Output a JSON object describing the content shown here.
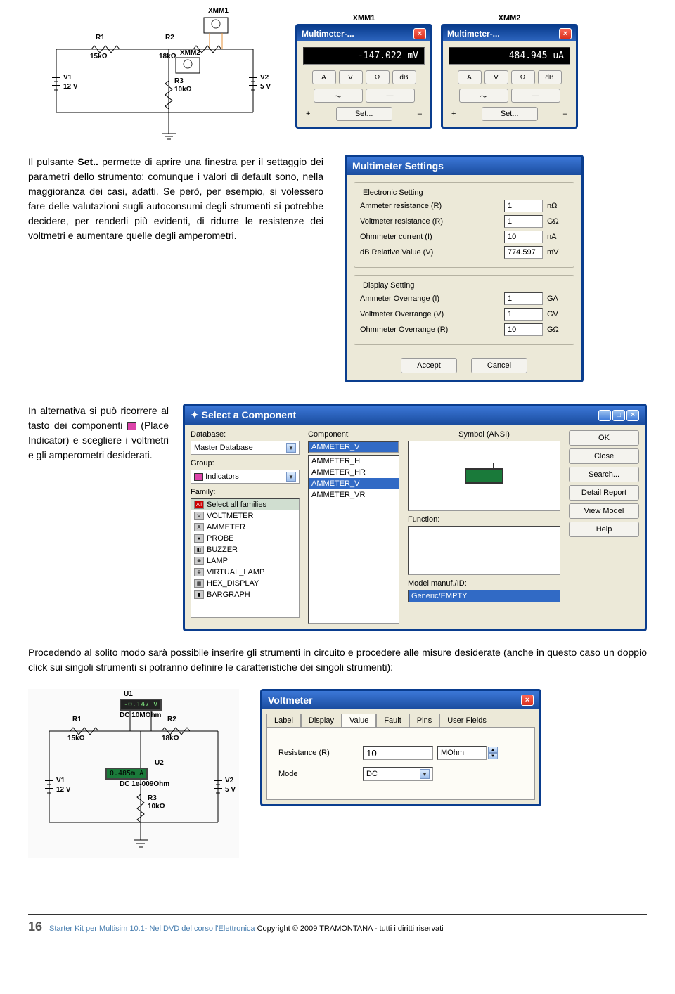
{
  "circuit1": {
    "xmm1_label": "XMM1",
    "xmm2_label": "XMM2",
    "r1": "R1",
    "r1_val": "15kΩ",
    "r2": "R2",
    "r2_val": "18kΩ",
    "r3": "R3",
    "r3_val": "10kΩ",
    "v1": "V1",
    "v1_val": "12 V",
    "v2": "V2",
    "v2_val": "5 V"
  },
  "meters": {
    "m1_label": "XMM1",
    "m2_label": "XMM2",
    "title": "Multimeter-...",
    "m1_value": "-147.022 mV",
    "m2_value": "484.945 uA",
    "btn_a": "A",
    "btn_v": "V",
    "btn_ohm": "Ω",
    "btn_db": "dB",
    "btn_ac": "〜",
    "btn_dc": "—",
    "plus": "+",
    "minus": "–",
    "set": "Set..."
  },
  "body_text": {
    "p1a": "Il pulsante ",
    "p1b": "Set..",
    "p1c": " permette di aprire una finestra per il settaggio dei parametri dello strumento: comunque i valori di default sono, nella maggioranza dei casi, adatti. Se però, per esempio, si volessero fare delle valutazioni sugli autoconsumi degli strumenti si potrebbe decidere, per renderli più evidenti, di ridurre le resistenze dei voltmetri e aumentare quelle degli amperometri.",
    "p2a": "In alternativa si può ricorrere al tasto dei componenti ",
    "p2b": " (Place Indicator) e scegliere i voltmetri e gli amperometri desiderati.",
    "p3": "Procedendo al solito modo sarà possibile inserire gli strumenti in circuito e procedere alle misure desiderate (anche in questo caso un doppio click sui singoli strumenti si potranno definire le caratteristiche dei singoli strumenti):"
  },
  "settings": {
    "title": "Multimeter Settings",
    "group1": "Electronic Setting",
    "ammeter_r_label": "Ammeter resistance (R)",
    "ammeter_r_val": "1",
    "ammeter_r_unit": "nΩ",
    "voltmeter_r_label": "Voltmeter resistance (R)",
    "voltmeter_r_val": "1",
    "voltmeter_r_unit": "GΩ",
    "ohmmeter_i_label": "Ohmmeter current (I)",
    "ohmmeter_i_val": "10",
    "ohmmeter_i_unit": "nA",
    "db_rel_label": "dB Relative Value (V)",
    "db_rel_val": "774.597",
    "db_rel_unit": "mV",
    "group2": "Display Setting",
    "amm_over_label": "Ammeter Overrange (I)",
    "amm_over_val": "1",
    "amm_over_unit": "GA",
    "volt_over_label": "Voltmeter Overrange (V)",
    "volt_over_val": "1",
    "volt_over_unit": "GV",
    "ohm_over_label": "Ohmmeter Overrange (R)",
    "ohm_over_val": "10",
    "ohm_over_unit": "GΩ",
    "accept": "Accept",
    "cancel": "Cancel"
  },
  "component": {
    "title": "Select a Component",
    "database_label": "Database:",
    "database_val": "Master Database",
    "group_label": "Group:",
    "group_val": "Indicators",
    "family_label": "Family:",
    "families": [
      "Select all families",
      "VOLTMETER",
      "AMMETER",
      "PROBE",
      "BUZZER",
      "LAMP",
      "VIRTUAL_LAMP",
      "HEX_DISPLAY",
      "BARGRAPH"
    ],
    "family_all": "All",
    "component_label": "Component:",
    "component_search": "AMMETER_V",
    "components": [
      "AMMETER_H",
      "AMMETER_HR",
      "AMMETER_V",
      "AMMETER_VR"
    ],
    "selected_component": "AMMETER_V",
    "symbol_label": "Symbol (ANSI)",
    "function_label": "Function:",
    "model_label": "Model manuf./ID:",
    "model_val": "Generic/EMPTY",
    "btn_ok": "OK",
    "btn_close": "Close",
    "btn_search": "Search...",
    "btn_detail": "Detail Report",
    "btn_view": "View Model",
    "btn_help": "Help"
  },
  "circuit2": {
    "u1": "U1",
    "u1_val": "-0.147",
    "u1_desc": "DC  10MOhm",
    "u2": "U2",
    "u2_val": "0.485m",
    "u2_desc": "DC  1e-009Ohm",
    "r1": "R1",
    "r1_val": "15kΩ",
    "r2": "R2",
    "r2_val": "18kΩ",
    "r3": "R3",
    "r3_val": "10kΩ",
    "v1": "V1",
    "v1_val": "12 V",
    "v2": "V2",
    "v2_val": "5 V"
  },
  "voltmeter": {
    "title": "Voltmeter",
    "tabs": [
      "Label",
      "Display",
      "Value",
      "Fault",
      "Pins",
      "User Fields"
    ],
    "active_tab": "Value",
    "resistance_label": "Resistance (R)",
    "resistance_val": "10",
    "resistance_unit": "MOhm",
    "mode_label": "Mode",
    "mode_val": "DC"
  },
  "footer": {
    "page": "16",
    "text_a": "Starter Kit per Multisim 10.1- Nel DVD del corso l'Elettronica ",
    "text_b": "Copyright © 2009 TRAMONTANA - tutti i diritti riservati"
  }
}
